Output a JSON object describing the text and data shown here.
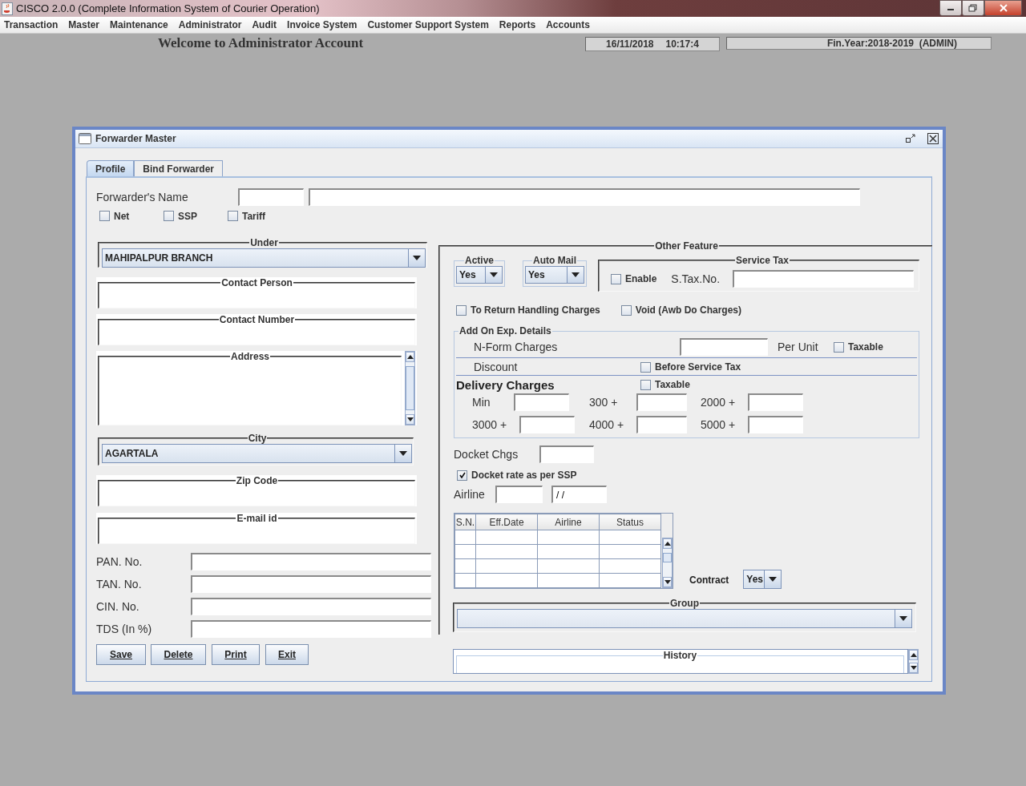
{
  "app_window": {
    "title": "CISCO 2.0.0 (Complete Information System of Courier Operation)"
  },
  "menu": [
    "Transaction",
    "Master",
    "Maintenance",
    "Administrator",
    "Audit",
    "Invoice System",
    "Customer Support System",
    "Reports",
    "Accounts"
  ],
  "welcome": "Welcome to Administrator Account",
  "status": {
    "date": "16/11/2018",
    "time": "10:17:4",
    "fin_year": "Fin.Year:2018-2019  (ADMIN)"
  },
  "dialog": {
    "title": "Forwarder Master",
    "tabs": [
      {
        "label": "Profile",
        "selected": true
      },
      {
        "label": "Bind Forwarder",
        "selected": false
      }
    ]
  },
  "profile": {
    "name_label": "Forwarder's Name",
    "flags": [
      {
        "label": "Net",
        "checked": false
      },
      {
        "label": "SSP",
        "checked": false
      },
      {
        "label": "Tariff",
        "checked": false
      }
    ],
    "under": {
      "legend": "Under",
      "value": "MAHIPALPUR BRANCH"
    },
    "contact_person": {
      "legend": "Contact Person"
    },
    "contact_number": {
      "legend": "Contact Number"
    },
    "address": {
      "legend": "Address"
    },
    "city": {
      "legend": "City",
      "value": "AGARTALA"
    },
    "zip_code": {
      "legend": "Zip Code"
    },
    "email": {
      "legend": "E-mail id"
    },
    "ids": [
      {
        "label": "PAN. No."
      },
      {
        "label": "TAN. No."
      },
      {
        "label": "CIN. No."
      },
      {
        "label": "TDS (In %)"
      }
    ],
    "buttons": [
      "Save",
      "Delete",
      "Print",
      "Exit"
    ]
  },
  "other": {
    "legend": "Other Feature",
    "active": {
      "legend": "Active",
      "value": "Yes"
    },
    "auto_mail": {
      "legend": "Auto Mail",
      "value": "Yes"
    },
    "service_tax": {
      "legend": "Service Tax",
      "enable": {
        "label": "Enable",
        "checked": false
      },
      "number_label": "S.Tax.No."
    },
    "options": [
      {
        "label": "To Return Handling Charges",
        "checked": false
      },
      {
        "label": "Void (Awb Do Charges)",
        "checked": false
      }
    ],
    "add_on": {
      "legend": "Add On Exp. Details",
      "nform_label": "N-Form Charges",
      "per_unit": "Per Unit",
      "nform_taxable": {
        "label": "Taxable",
        "checked": false
      },
      "discount_label": "Discount",
      "before_tax": {
        "label": "Before Service Tax",
        "checked": false
      },
      "delivery_label": "Delivery Charges",
      "delivery_taxable": {
        "label": "Taxable",
        "checked": false
      },
      "slabs": [
        "Min",
        "300 +",
        "2000 +",
        "3000 +",
        "4000 +",
        "5000 +"
      ]
    },
    "docket_label": "Docket Chgs",
    "docket_ssp": {
      "label": "Docket rate as per SSP",
      "checked": true
    },
    "airline": {
      "label": "Airline",
      "date_value": "/ /"
    },
    "table": {
      "columns": [
        "S.N.",
        "Eff.Date",
        "Airline",
        "Status"
      ]
    },
    "contract": {
      "label": "Contract",
      "value": "Yes"
    },
    "group": {
      "legend": "Group"
    },
    "history": {
      "legend": "History"
    }
  }
}
